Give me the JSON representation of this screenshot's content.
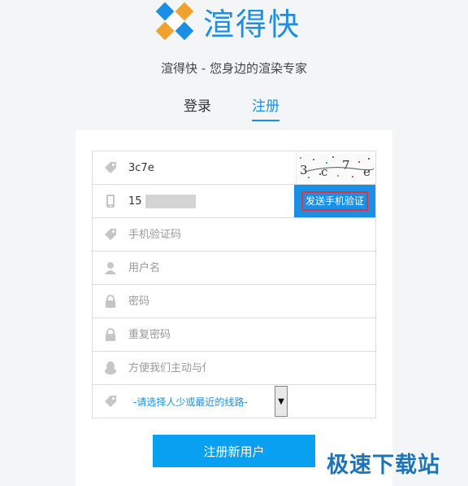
{
  "brand": {
    "name": "渲得快",
    "slogan": "渲得快 - 您身边的渲染专家"
  },
  "tabs": {
    "login": "登录",
    "register": "注册"
  },
  "form": {
    "captcha_value": "3c7e",
    "captcha_chars": [
      "3",
      "c",
      "7",
      "e"
    ],
    "phone_value": "15",
    "send_code_label": "发送手机验证",
    "sms_code_placeholder": "手机验证码",
    "username_placeholder": "用户名",
    "password_placeholder": "密码",
    "confirm_password_placeholder": "重复密码",
    "qq_placeholder": "方便我们主动与你联系",
    "route_select_label": "-请选择人少或最近的线路-",
    "submit_label": "注册新用户"
  },
  "watermark": "极速下载站",
  "colors": {
    "accent": "#1a8fe3",
    "logo_orange": "#f0a22e",
    "highlight": "#e2323c"
  }
}
